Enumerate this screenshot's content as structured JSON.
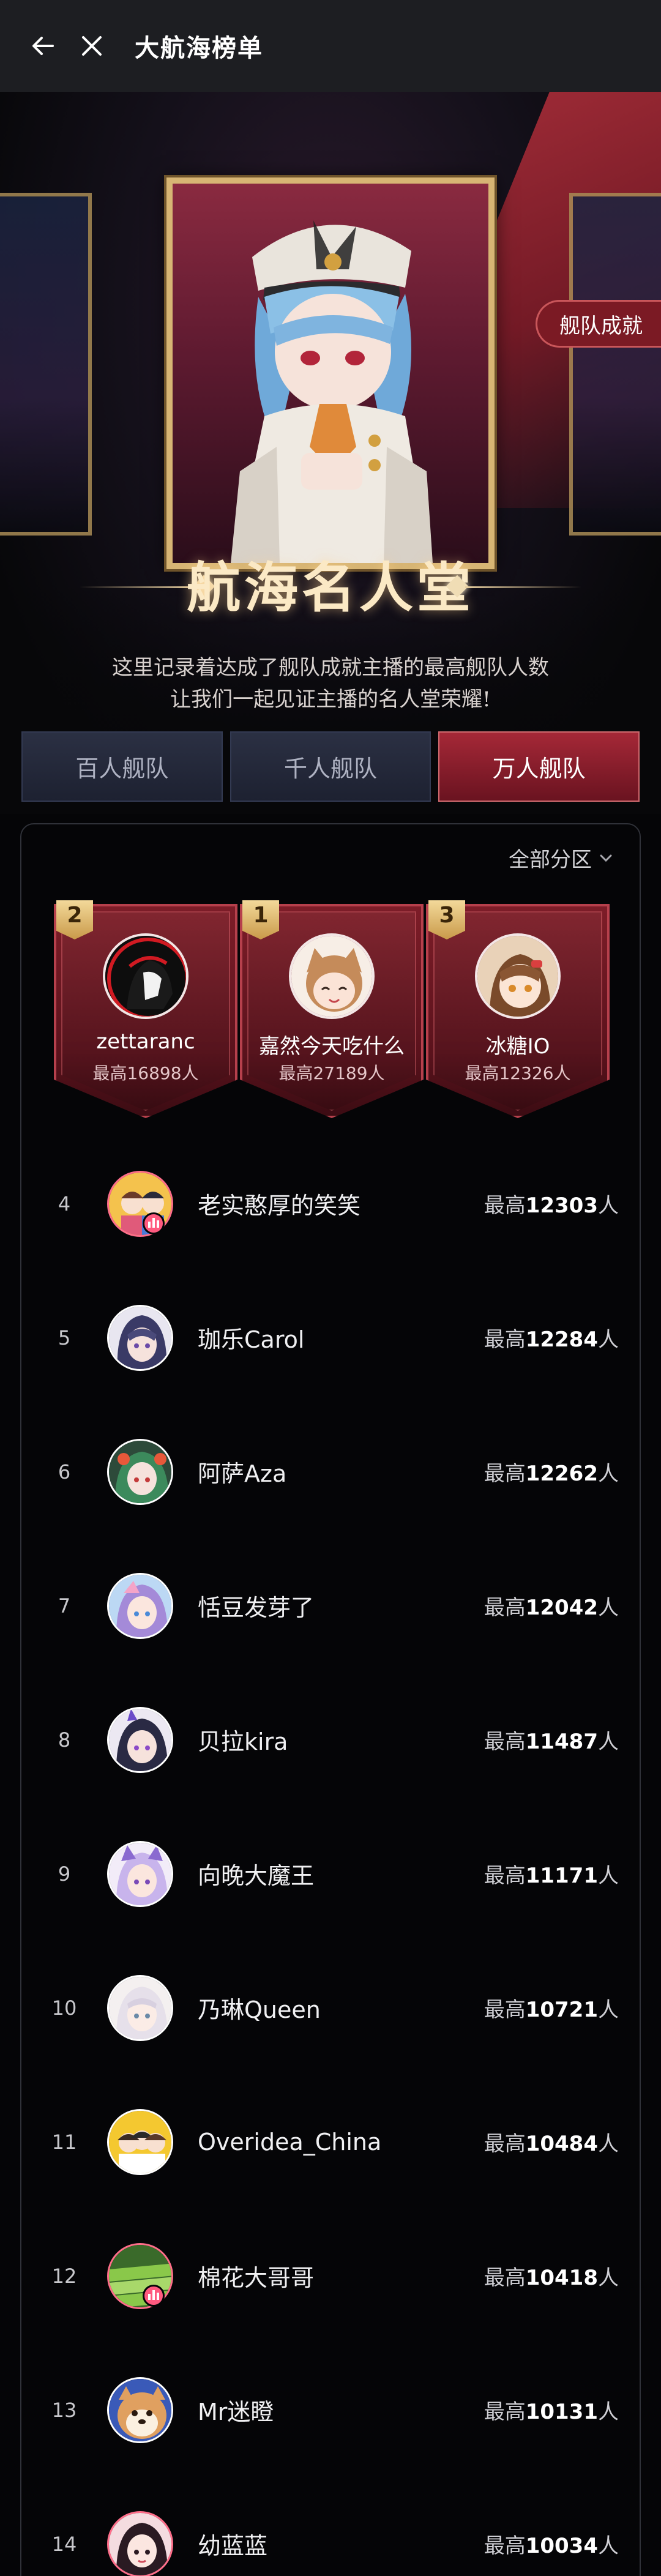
{
  "topbar": {
    "title": "大航海榜单"
  },
  "hero": {
    "fleet_badge": "舰队成就",
    "hall_title": "航海名人堂",
    "desc_line1": "这里记录着达成了舰队成就主播的最高舰队人数",
    "desc_line2": "让我们一起见证主播的名人堂荣耀!"
  },
  "tabs": [
    {
      "label": "百人舰队",
      "active": false
    },
    {
      "label": "千人舰队",
      "active": false
    },
    {
      "label": "万人舰队",
      "active": true
    }
  ],
  "filter": {
    "label": "全部分区"
  },
  "podium": [
    {
      "rank": "2",
      "name": "zettaranc",
      "max": "最高16898人"
    },
    {
      "rank": "1",
      "name": "嘉然今天吃什么",
      "max": "最高27189人"
    },
    {
      "rank": "3",
      "name": "冰糖IO",
      "max": "最高12326人"
    }
  ],
  "list": [
    {
      "rank": "4",
      "name": "老实憨厚的笑笑",
      "prefix": "最高",
      "count": "12303",
      "suffix": "人",
      "live": true
    },
    {
      "rank": "5",
      "name": "珈乐Carol",
      "prefix": "最高",
      "count": "12284",
      "suffix": "人",
      "live": false
    },
    {
      "rank": "6",
      "name": "阿萨Aza",
      "prefix": "最高",
      "count": "12262",
      "suffix": "人",
      "live": false
    },
    {
      "rank": "7",
      "name": "恬豆发芽了",
      "prefix": "最高",
      "count": "12042",
      "suffix": "人",
      "live": false
    },
    {
      "rank": "8",
      "name": "贝拉kira",
      "prefix": "最高",
      "count": "11487",
      "suffix": "人",
      "live": false
    },
    {
      "rank": "9",
      "name": "向晚大魔王",
      "prefix": "最高",
      "count": "11171",
      "suffix": "人",
      "live": false
    },
    {
      "rank": "10",
      "name": "乃琳Queen",
      "prefix": "最高",
      "count": "10721",
      "suffix": "人",
      "live": false
    },
    {
      "rank": "11",
      "name": "Overidea_China",
      "prefix": "最高",
      "count": "10484",
      "suffix": "人",
      "live": false
    },
    {
      "rank": "12",
      "name": "棉花大哥哥",
      "prefix": "最高",
      "count": "10418",
      "suffix": "人",
      "live": true
    },
    {
      "rank": "13",
      "name": "Mr迷瞪",
      "prefix": "最高",
      "count": "10131",
      "suffix": "人",
      "live": false
    },
    {
      "rank": "14",
      "name": "幼蓝蓝",
      "prefix": "最高",
      "count": "10034",
      "suffix": "人",
      "live": false
    }
  ],
  "colors": {
    "accent_red": "#a52837",
    "gold": "#d7b574",
    "background": "#050507"
  }
}
